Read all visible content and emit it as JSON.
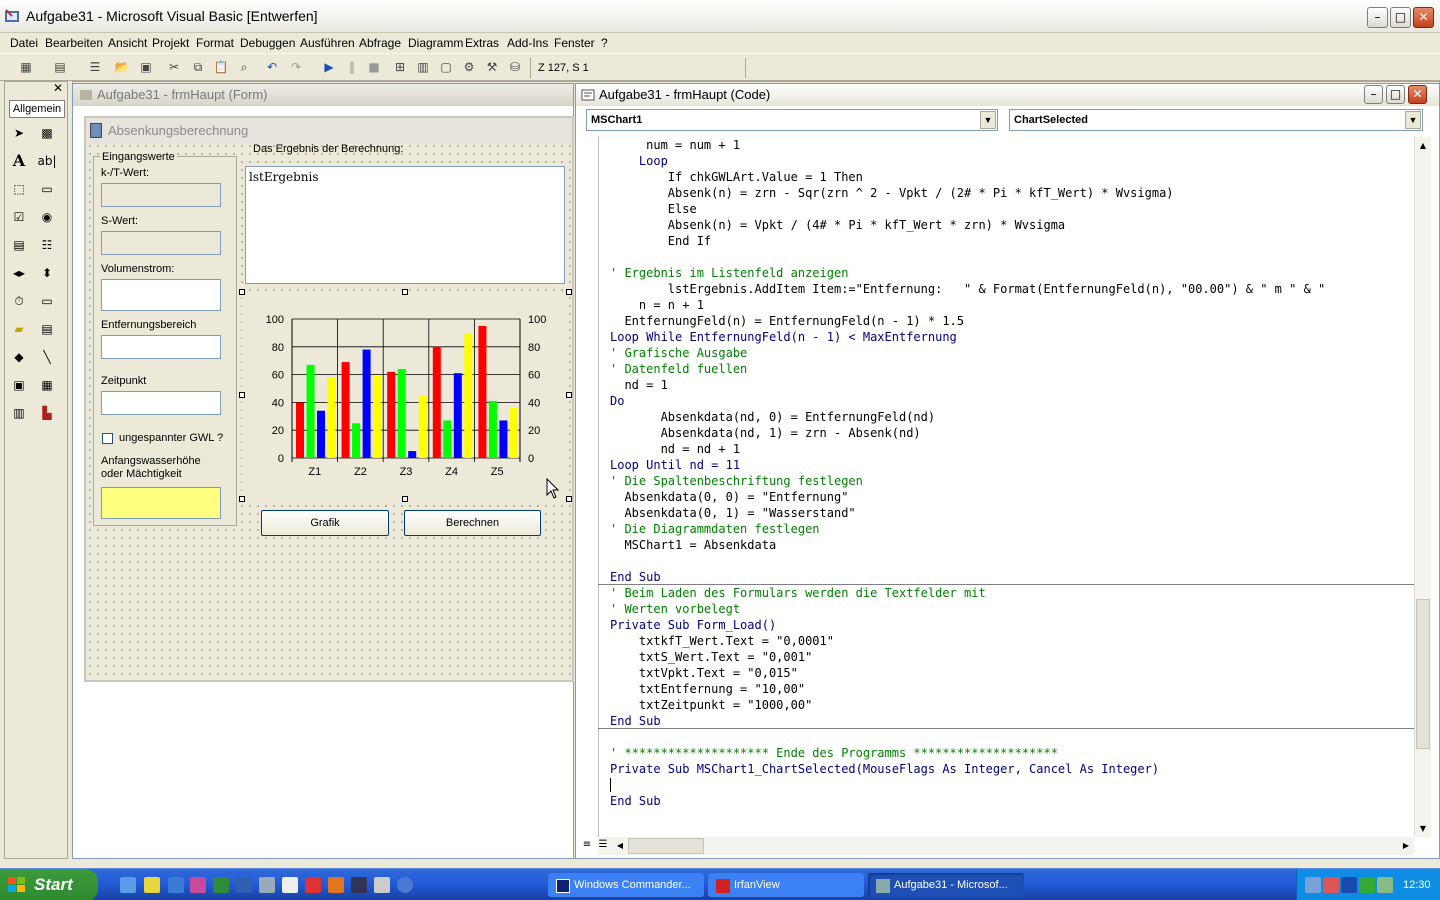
{
  "app": {
    "title": "Aufgabe31 - Microsoft Visual Basic [Entwerfen]",
    "menu": [
      "Datei",
      "Bearbeiten",
      "Ansicht",
      "Projekt",
      "Format",
      "Debuggen",
      "Ausführen",
      "Abfrage",
      "Diagramm",
      "Extras",
      "Add-Ins",
      "Fenster",
      "?"
    ],
    "position": "Z 127, S 1"
  },
  "toolbox": {
    "tab": "Allgemein",
    "close": "✕"
  },
  "form_window": {
    "title": "Aufgabe31 - frmHaupt (Form)",
    "form_caption": "Absenkungsberechnung",
    "frame_label": "Eingangswerte",
    "kf_label": "k-/T-Wert:",
    "s_label": "S-Wert:",
    "volumen_label": "Volumenstrom:",
    "entfernung_label": "Entfernungsbereich",
    "zeitpunkt_label": "Zeitpunkt",
    "gwl_label": "ungespannter GWL ?",
    "anfang_label": "Anfangswasserhöhe oder Mächtigkeit",
    "ergebnis_label": "Das Ergebnis der Berechnung:",
    "list_text": "lstErgebnis",
    "grafik_button": "Grafik",
    "berechnen_button": "Berechnen"
  },
  "chart_data": {
    "type": "bar",
    "categories": [
      "Z1",
      "Z2",
      "Z3",
      "Z4",
      "Z5"
    ],
    "series": [
      {
        "color": "#ff0000",
        "values": [
          40,
          69,
          62,
          80,
          95
        ]
      },
      {
        "color": "#00ff00",
        "values": [
          67,
          25,
          64,
          27,
          41
        ]
      },
      {
        "color": "#0000ff",
        "values": [
          34,
          78,
          5,
          61,
          27
        ]
      },
      {
        "color": "#ffff00",
        "values": [
          58,
          59,
          45,
          90,
          36
        ]
      }
    ],
    "ylim": [
      0,
      100
    ],
    "yticks": [
      0,
      20,
      40,
      60,
      80,
      100
    ],
    "grid": true
  },
  "code_window": {
    "title": "Aufgabe31 - frmHaupt (Code)",
    "object_combo": "MSChart1",
    "proc_combo": "ChartSelected",
    "lines": [
      {
        "t": "     num = num + 1",
        "k": "n"
      },
      {
        "t": "    Loop",
        "k": "kw"
      },
      {
        "t": "        If chkGWLArt.Value = 1 Then",
        "k": "n"
      },
      {
        "t": "        Absenk(n) = zrn - Sqr(zrn ^ 2 - Vpkt / (2# * Pi * kfT_Wert) * Wvsigma)",
        "k": "n"
      },
      {
        "t": "        Else",
        "k": "n"
      },
      {
        "t": "        Absenk(n) = Vpkt / (4# * Pi * kfT_Wert * zrn) * Wvsigma",
        "k": "n"
      },
      {
        "t": "        End If",
        "k": "n"
      },
      {
        "t": "",
        "k": "n"
      },
      {
        "t": "' Ergebnis im Listenfeld anzeigen",
        "k": "cm"
      },
      {
        "t": "        lstErgebnis.AddItem Item:=\"Entfernung:   \" & Format(EntfernungFeld(n), \"00.00\") & \" m \" & \"",
        "k": "n"
      },
      {
        "t": "    n = n + 1",
        "k": "n"
      },
      {
        "t": "  EntfernungFeld(n) = EntfernungFeld(n - 1) * 1.5",
        "k": "n"
      },
      {
        "t": "Loop While EntfernungFeld(n - 1) < MaxEntfernung",
        "k": "kw"
      },
      {
        "t": "' Grafische Ausgabe",
        "k": "cm"
      },
      {
        "t": "' Datenfeld fuellen",
        "k": "cm"
      },
      {
        "t": "  nd = 1",
        "k": "n"
      },
      {
        "t": "Do",
        "k": "kw"
      },
      {
        "t": "       Absenkdata(nd, 0) = EntfernungFeld(nd)",
        "k": "n"
      },
      {
        "t": "       Absenkdata(nd, 1) = zrn - Absenk(nd)",
        "k": "n"
      },
      {
        "t": "       nd = nd + 1",
        "k": "n"
      },
      {
        "t": "Loop Until nd = 11",
        "k": "kw"
      },
      {
        "t": "' Die Spaltenbeschriftung festlegen",
        "k": "cm"
      },
      {
        "t": "  Absenkdata(0, 0) = \"Entfernung\"",
        "k": "n"
      },
      {
        "t": "  Absenkdata(0, 1) = \"Wasserstand\"",
        "k": "n"
      },
      {
        "t": "' Die Diagrammdaten festlegen",
        "k": "cm"
      },
      {
        "t": "  MSChart1 = Absenkdata",
        "k": "n"
      },
      {
        "t": "",
        "k": "n"
      },
      {
        "t": "End Sub",
        "k": "kw"
      },
      {
        "t": "' Beim Laden des Formulars werden die Textfelder mit",
        "k": "cm"
      },
      {
        "t": "' Werten vorbelegt",
        "k": "cm"
      },
      {
        "t": "Private Sub Form_Load()",
        "k": "kw"
      },
      {
        "t": "    txtkfT_Wert.Text = \"0,0001\"",
        "k": "n"
      },
      {
        "t": "    txtS_Wert.Text = \"0,001\"",
        "k": "n"
      },
      {
        "t": "    txtVpkt.Text = \"0,015\"",
        "k": "n"
      },
      {
        "t": "    txtEntfernung = \"10,00\"",
        "k": "n"
      },
      {
        "t": "    txtZeitpunkt = \"1000,00\"",
        "k": "n"
      },
      {
        "t": "End Sub",
        "k": "kw"
      },
      {
        "t": "",
        "k": "n"
      },
      {
        "t": "' ******************** Ende des Programms ********************",
        "k": "cm"
      },
      {
        "t": "Private Sub MSChart1_ChartSelected(MouseFlags As Integer, Cancel As Integer)",
        "k": "kw"
      },
      {
        "t": "",
        "k": "n"
      },
      {
        "t": "End Sub",
        "k": "kw"
      }
    ]
  },
  "taskbar": {
    "start": "Start",
    "tasks": [
      "Windows Commander...",
      "IrfanView",
      "Aufgabe31 - Microsof..."
    ],
    "clock": "12:30"
  }
}
